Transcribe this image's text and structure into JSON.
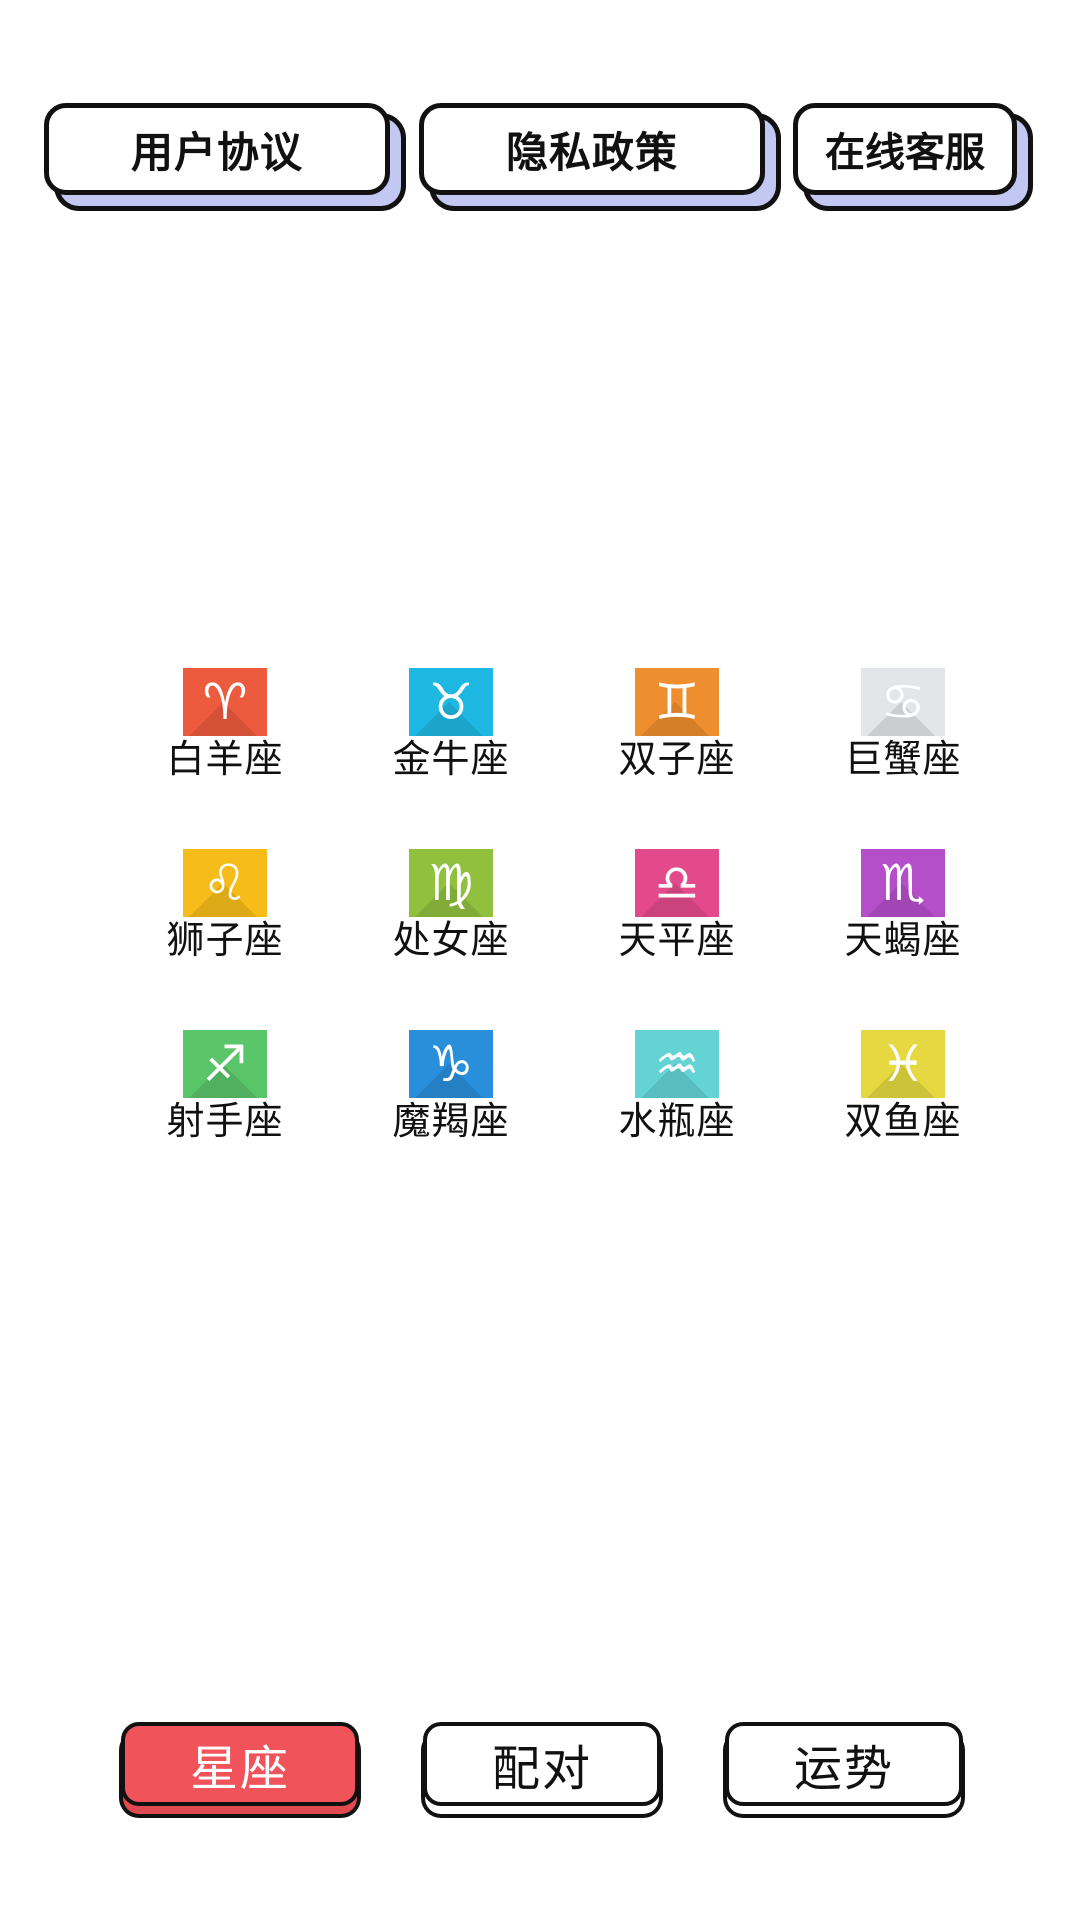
{
  "header": {
    "agreement_label": "用户协议",
    "privacy_label": "隐私政策",
    "service_label": "在线客服"
  },
  "zodiac": {
    "signs": [
      {
        "label": "白羊座",
        "symbol": "♈",
        "color": "#ec5b3e",
        "icon": "aries-icon"
      },
      {
        "label": "金牛座",
        "symbol": "♉",
        "color": "#1fb8e2",
        "icon": "taurus-icon"
      },
      {
        "label": "双子座",
        "symbol": "♊",
        "color": "#ef8e2e",
        "icon": "gemini-icon"
      },
      {
        "label": "巨蟹座",
        "symbol": "♋",
        "color": "#e3e6e8",
        "icon": "cancer-icon"
      },
      {
        "label": "狮子座",
        "symbol": "♌",
        "color": "#f6bd1a",
        "icon": "leo-icon"
      },
      {
        "label": "处女座",
        "symbol": "♍",
        "color": "#90c03e",
        "icon": "virgo-icon"
      },
      {
        "label": "天平座",
        "symbol": "♎",
        "color": "#e24a8c",
        "icon": "libra-icon"
      },
      {
        "label": "天蝎座",
        "symbol": "♏",
        "color": "#b44ec9",
        "icon": "scorpio-icon"
      },
      {
        "label": "射手座",
        "symbol": "♐",
        "color": "#5bc56a",
        "icon": "sagittarius-icon"
      },
      {
        "label": "魔羯座",
        "symbol": "♑",
        "color": "#2a8fda",
        "icon": "capricorn-icon"
      },
      {
        "label": "水瓶座",
        "symbol": "♒",
        "color": "#63d3d4",
        "icon": "aquarius-icon"
      },
      {
        "label": "双鱼座",
        "symbol": "♓",
        "color": "#e5d840",
        "icon": "pisces-icon"
      }
    ]
  },
  "tabs": {
    "items": [
      {
        "label": "星座",
        "active": true
      },
      {
        "label": "配对",
        "active": false
      },
      {
        "label": "运势",
        "active": false
      }
    ],
    "active_color": "#f0545a"
  }
}
